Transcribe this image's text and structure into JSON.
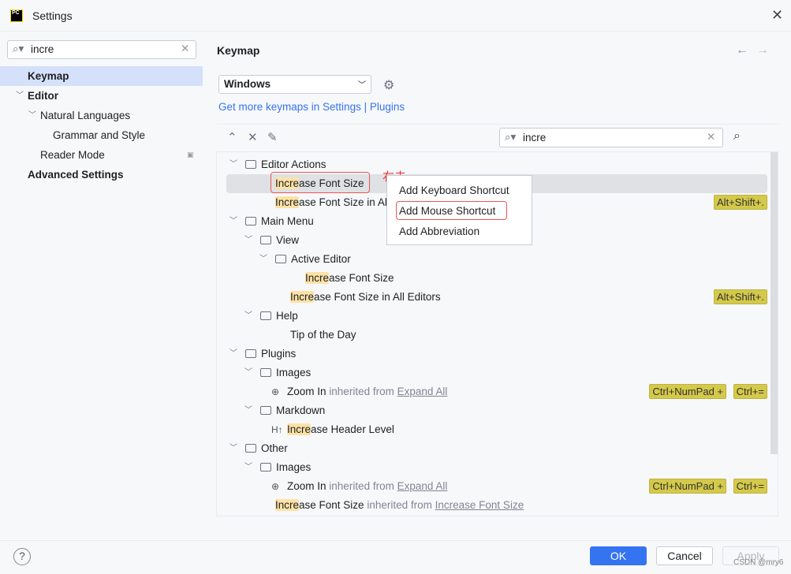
{
  "window": {
    "title": "Settings",
    "logo": "PC"
  },
  "sidebar": {
    "search_value": "incre",
    "items": [
      {
        "label": "Keymap",
        "bold": true,
        "selected": true
      },
      {
        "label": "Editor",
        "bold": true
      },
      {
        "label": "Natural Languages"
      },
      {
        "label": "Grammar and Style"
      },
      {
        "label": "Reader Mode"
      },
      {
        "label": "Advanced Settings",
        "bold": true
      }
    ]
  },
  "main": {
    "header": "Keymap",
    "keymap": "Windows",
    "link1": "Get more keymaps in Settings",
    "link_sep": "|",
    "link2": "Plugins",
    "tree_search": "incre"
  },
  "tree": [
    {
      "level": 0,
      "type": "folder",
      "text": "Editor Actions"
    },
    {
      "level": 1,
      "type": "leaf",
      "hl": "Incre",
      "text": "ase Font Size",
      "selected": true
    },
    {
      "level": 1,
      "type": "leaf",
      "hl": "Incre",
      "text": "ase Font Size in All Editors",
      "shortcuts": [
        "Alt+Shift+."
      ]
    },
    {
      "level": 0,
      "type": "folder",
      "text": "Main Menu"
    },
    {
      "level": 1,
      "type": "folder",
      "text": "View"
    },
    {
      "level": 2,
      "type": "folder",
      "text": "Active Editor"
    },
    {
      "level": 3,
      "type": "leaf",
      "hl": "Incre",
      "text": "ase Font Size"
    },
    {
      "level": 2,
      "type": "leaf",
      "hl": "Incre",
      "text": "ase Font Size in All Editors",
      "shortcuts": [
        "Alt+Shift+."
      ]
    },
    {
      "level": 1,
      "type": "folder",
      "text": "Help"
    },
    {
      "level": 2,
      "type": "leaf",
      "text": "Tip of the Day"
    },
    {
      "level": 0,
      "type": "folder",
      "text": "Plugins"
    },
    {
      "level": 1,
      "type": "folder",
      "text": "Images"
    },
    {
      "level": 2,
      "type": "leaf",
      "icon": "⊕",
      "text": "Zoom In",
      "inherited": "inherited from",
      "link": "Expand All",
      "shortcuts": [
        "Ctrl+NumPad +",
        "Ctrl+="
      ]
    },
    {
      "level": 1,
      "type": "folder",
      "text": "Markdown"
    },
    {
      "level": 2,
      "type": "leaf",
      "icon": "H↑",
      "hl": "Incre",
      "text": "ase Header Level"
    },
    {
      "level": 0,
      "type": "folder",
      "text": "Other"
    },
    {
      "level": 1,
      "type": "folder",
      "text": "Images"
    },
    {
      "level": 2,
      "type": "leaf",
      "icon": "⊕",
      "text": "Zoom In",
      "inherited": "inherited from",
      "link": "Expand All",
      "shortcuts": [
        "Ctrl+NumPad +",
        "Ctrl+="
      ]
    },
    {
      "level": 1,
      "type": "leaf",
      "hl": "Incre",
      "text": "ase Font Size",
      "inherited": "inherited from",
      "link": "Increase Font Size"
    }
  ],
  "context_menu": {
    "items": [
      "Add Keyboard Shortcut",
      "Add Mouse Shortcut",
      "Add Abbreviation"
    ]
  },
  "annotation": "右击",
  "footer": {
    "ok": "OK",
    "cancel": "Cancel",
    "apply": "Apply",
    "help": "?",
    "watermark": "CSDN @mry6"
  },
  "colors": {
    "accent": "#3574f0",
    "selection": "#d5e1fb",
    "highlight": "#fde2a6",
    "shortcut": "#d4c94a",
    "annotation": "#e33"
  }
}
